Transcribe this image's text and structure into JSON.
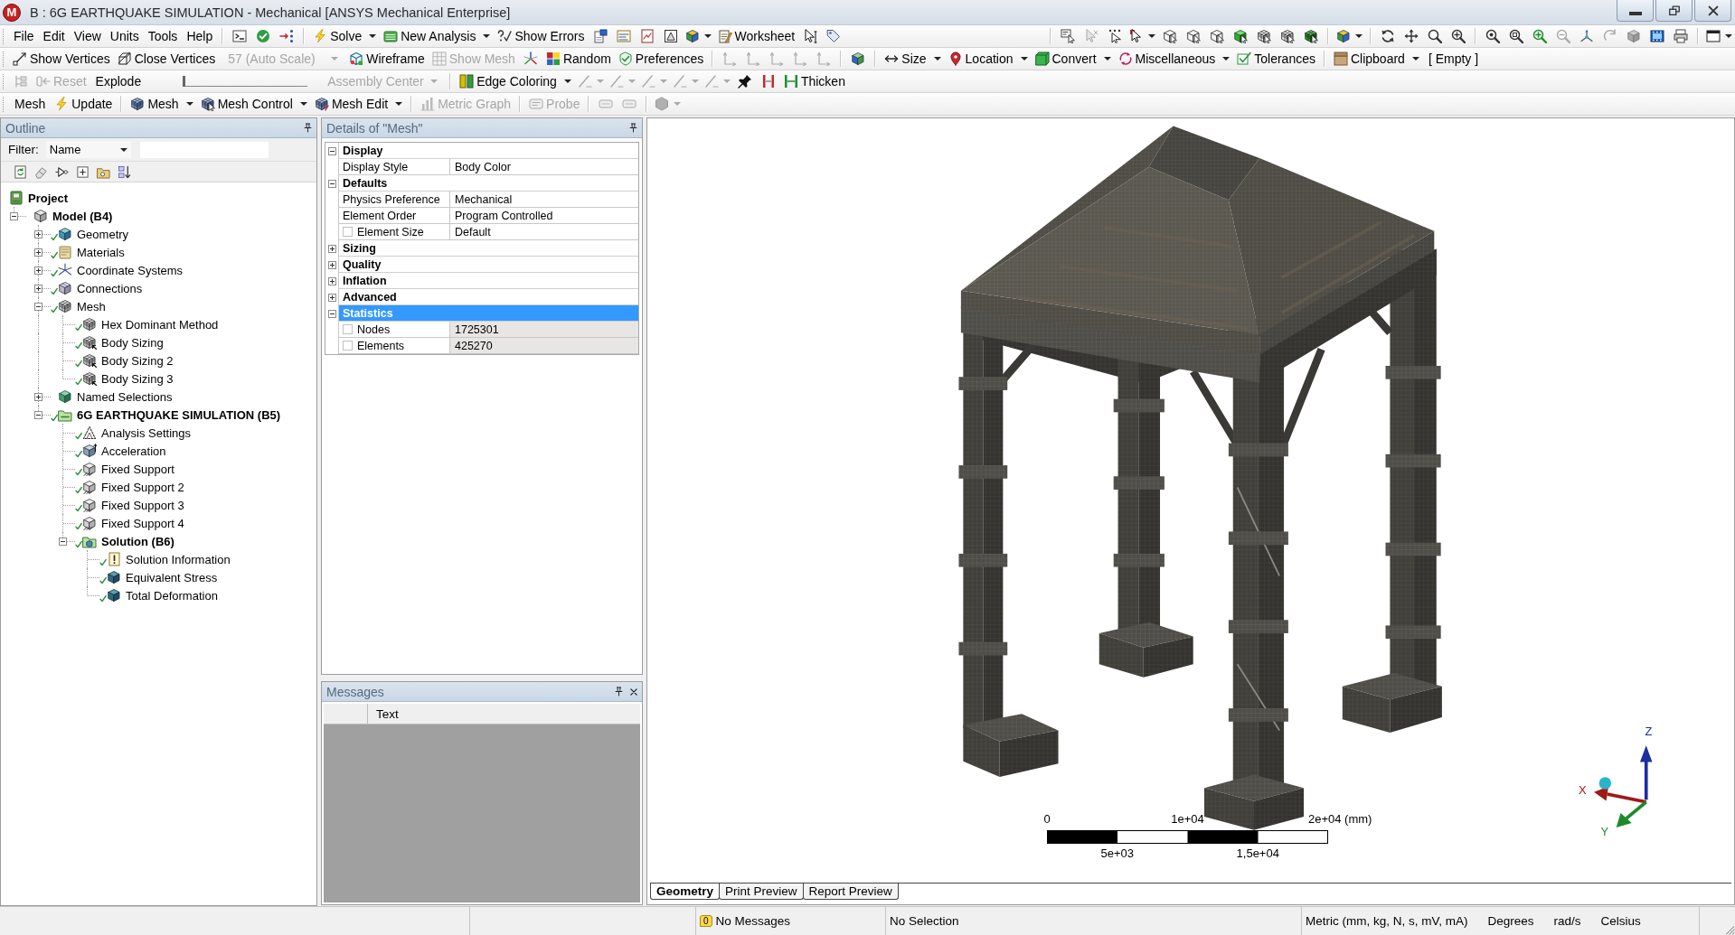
{
  "window": {
    "logo": "M",
    "title": "B : 6G EARTHQUAKE SIMULATION - Mechanical [ANSYS Mechanical Enterprise]"
  },
  "menu": [
    "File",
    "Edit",
    "View",
    "Units",
    "Tools",
    "Help"
  ],
  "toolbars": [
    [
      {
        "kind": "button",
        "label": "Solve",
        "dropdown": true,
        "disabled": false
      },
      {
        "kind": "button",
        "label": "New Analysis",
        "dropdown": true,
        "disabled": false
      },
      {
        "kind": "button",
        "label": "Show Errors",
        "dropdown": false,
        "disabled": false
      },
      {
        "kind": "button",
        "label": "Worksheet",
        "dropdown": false,
        "disabled": false
      }
    ],
    [
      {
        "kind": "button",
        "label": "Show Vertices",
        "dropdown": false,
        "disabled": false
      },
      {
        "kind": "button",
        "label": "Close Vertices",
        "dropdown": false,
        "disabled": false
      },
      {
        "kind": "combo",
        "value": "57 (Auto Scale)",
        "disabled": true
      },
      {
        "kind": "button",
        "label": "Wireframe",
        "dropdown": false,
        "disabled": false
      },
      {
        "kind": "button",
        "label": "Show Mesh",
        "dropdown": false,
        "disabled": true
      },
      {
        "kind": "button",
        "label": "Random",
        "dropdown": false,
        "disabled": false
      },
      {
        "kind": "button",
        "label": "Preferences",
        "dropdown": false,
        "disabled": false
      },
      {
        "kind": "button",
        "label": "Size",
        "dropdown": true,
        "disabled": false
      },
      {
        "kind": "button",
        "label": "Location",
        "dropdown": true,
        "disabled": false
      },
      {
        "kind": "button",
        "label": "Convert",
        "dropdown": true,
        "disabled": false
      },
      {
        "kind": "button",
        "label": "Miscellaneous",
        "dropdown": true,
        "disabled": false
      },
      {
        "kind": "button",
        "label": "Tolerances",
        "dropdown": false,
        "disabled": false
      },
      {
        "kind": "button",
        "label": "Clipboard",
        "dropdown": true,
        "disabled": false
      },
      {
        "kind": "label",
        "label": "[ Empty ]"
      }
    ],
    [
      {
        "kind": "button",
        "label": "Reset",
        "dropdown": false,
        "disabled": true
      },
      {
        "kind": "label",
        "label": "Explode"
      },
      {
        "kind": "slider",
        "level": 0
      },
      {
        "kind": "combo",
        "value": "Assembly Center",
        "disabled": true
      },
      {
        "kind": "button",
        "label": "Edge Coloring",
        "dropdown": true,
        "disabled": false
      },
      {
        "kind": "button",
        "label": "Thicken",
        "dropdown": false,
        "disabled": false
      }
    ],
    [
      {
        "kind": "label",
        "label": "Mesh"
      },
      {
        "kind": "button",
        "label": "Update",
        "dropdown": false,
        "disabled": false
      },
      {
        "kind": "button",
        "label": "Mesh",
        "dropdown": true,
        "disabled": false
      },
      {
        "kind": "button",
        "label": "Mesh Control",
        "dropdown": true,
        "disabled": false
      },
      {
        "kind": "button",
        "label": "Mesh Edit",
        "dropdown": true,
        "disabled": false
      },
      {
        "kind": "button",
        "label": "Metric Graph",
        "dropdown": false,
        "disabled": true
      },
      {
        "kind": "button",
        "label": "Probe",
        "dropdown": false,
        "disabled": true
      }
    ]
  ],
  "outline": {
    "title": "Outline",
    "filter_label": "Filter:",
    "filter_by": "Name",
    "tree": [
      {
        "label": "Project",
        "kind": "project",
        "ok": false,
        "children": [
          {
            "label": "Model (B4)",
            "kind": "model",
            "ok": false,
            "expanded": true,
            "children": [
              {
                "label": "Geometry",
                "kind": "geometry",
                "ok": true,
                "expanded": false
              },
              {
                "label": "Materials",
                "kind": "materials",
                "ok": true,
                "expanded": false
              },
              {
                "label": "Coordinate Systems",
                "kind": "coordinates",
                "ok": true,
                "expanded": false
              },
              {
                "label": "Connections",
                "kind": "connections",
                "ok": true,
                "expanded": false
              },
              {
                "label": "Mesh",
                "kind": "mesh",
                "ok": true,
                "expanded": true,
                "children": [
                  {
                    "label": "Hex Dominant Method",
                    "kind": "method",
                    "ok": true
                  },
                  {
                    "label": "Body Sizing",
                    "kind": "sizing",
                    "ok": true
                  },
                  {
                    "label": "Body Sizing 2",
                    "kind": "sizing",
                    "ok": true
                  },
                  {
                    "label": "Body Sizing 3",
                    "kind": "sizing",
                    "ok": true
                  }
                ]
              },
              {
                "label": "Named Selections",
                "kind": "named_selections",
                "ok": false,
                "expanded": false
              },
              {
                "label": "6G EARTHQUAKE SIMULATION (B5)",
                "kind": "analysis",
                "ok": true,
                "expanded": true,
                "children": [
                  {
                    "label": "Analysis Settings",
                    "kind": "settings",
                    "ok": true
                  },
                  {
                    "label": "Acceleration",
                    "kind": "acceleration",
                    "ok": true
                  },
                  {
                    "label": "Fixed Support",
                    "kind": "support",
                    "ok": true
                  },
                  {
                    "label": "Fixed Support 2",
                    "kind": "support",
                    "ok": true
                  },
                  {
                    "label": "Fixed Support 3",
                    "kind": "support",
                    "ok": true
                  },
                  {
                    "label": "Fixed Support 4",
                    "kind": "support",
                    "ok": true
                  },
                  {
                    "label": "Solution (B6)",
                    "kind": "solution",
                    "ok": true,
                    "expanded": true,
                    "children": [
                      {
                        "label": "Solution Information",
                        "kind": "information",
                        "ok": true
                      },
                      {
                        "label": "Equivalent Stress",
                        "kind": "result",
                        "ok": true
                      },
                      {
                        "label": "Total Deformation",
                        "kind": "result",
                        "ok": true
                      }
                    ]
                  }
                ]
              }
            ]
          }
        ]
      }
    ]
  },
  "details": {
    "title": "Details of \"Mesh\"",
    "groups": [
      {
        "name": "Display",
        "expanded": true,
        "selected": false,
        "rows": [
          {
            "kind": "property",
            "name": "Display Style",
            "value": "Body Color",
            "readonly": false
          }
        ]
      },
      {
        "name": "Defaults",
        "expanded": true,
        "selected": false,
        "rows": [
          {
            "kind": "property",
            "name": "Physics Preference",
            "value": "Mechanical",
            "readonly": false
          },
          {
            "kind": "property",
            "name": "Element Order",
            "value": "Program Controlled",
            "readonly": false
          },
          {
            "kind": "parameter",
            "name": "Element Size",
            "value": "Default",
            "checked": false,
            "readonly": false
          }
        ]
      },
      {
        "name": "Sizing",
        "expanded": false,
        "selected": false
      },
      {
        "name": "Quality",
        "expanded": false,
        "selected": false
      },
      {
        "name": "Inflation",
        "expanded": false,
        "selected": false
      },
      {
        "name": "Advanced",
        "expanded": false,
        "selected": false
      },
      {
        "name": "Statistics",
        "expanded": true,
        "selected": true,
        "rows": [
          {
            "kind": "parameter",
            "name": "Nodes",
            "value": "1725301",
            "checked": false,
            "readonly": true
          },
          {
            "kind": "parameter",
            "name": "Elements",
            "value": "425270",
            "checked": false,
            "readonly": true
          }
        ]
      }
    ]
  },
  "messages": {
    "title": "Messages",
    "columns": [
      "Text"
    ]
  },
  "viewport": {
    "scale_bar": {
      "top_labels": [
        "0",
        "1e+04",
        "2e+04 (mm)"
      ],
      "bottom_labels": [
        "5e+03",
        "1,5e+04"
      ]
    },
    "triad": {
      "x": "X",
      "y": "Y",
      "z": "Z"
    },
    "tabs": [
      {
        "label": "Geometry",
        "selected": true
      },
      {
        "label": "Print Preview",
        "selected": false
      },
      {
        "label": "Report Preview",
        "selected": false
      }
    ]
  },
  "status_bar": {
    "message_count": "0",
    "messages": "No Messages",
    "selection": "No Selection",
    "units": [
      "Metric (mm, kg, N, s, mV, mA)",
      "Degrees",
      "rad/s",
      "Celsius"
    ]
  }
}
